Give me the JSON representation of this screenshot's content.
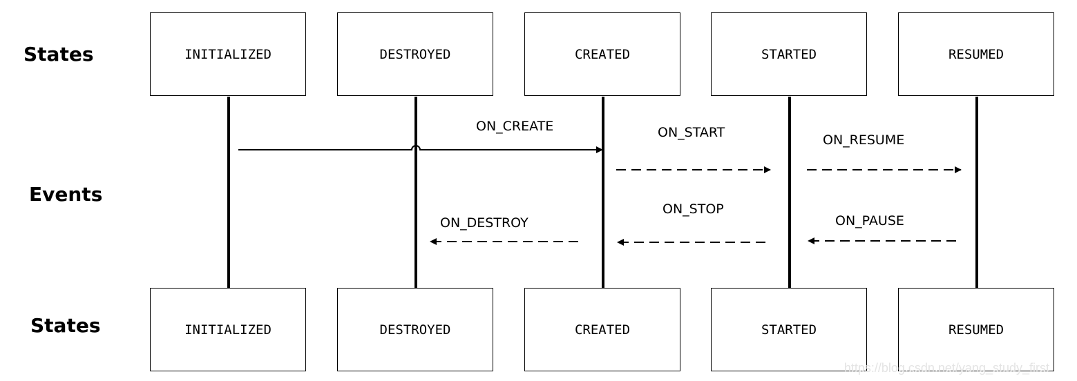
{
  "diagram": {
    "row_labels": {
      "top_states": "States",
      "events": "Events",
      "bottom_states": "States"
    },
    "states": [
      "INITIALIZED",
      "DESTROYED",
      "CREATED",
      "STARTED",
      "RESUMED"
    ],
    "events": [
      {
        "label": "ON_CREATE",
        "from": "INITIALIZED",
        "to": "CREATED",
        "style": "solid",
        "direction": "forward"
      },
      {
        "label": "ON_START",
        "from": "CREATED",
        "to": "STARTED",
        "style": "dashed",
        "direction": "forward"
      },
      {
        "label": "ON_RESUME",
        "from": "STARTED",
        "to": "RESUMED",
        "style": "dashed",
        "direction": "forward"
      },
      {
        "label": "ON_DESTROY",
        "from": "CREATED",
        "to": "DESTROYED",
        "style": "dashed",
        "direction": "backward"
      },
      {
        "label": "ON_STOP",
        "from": "STARTED",
        "to": "CREATED",
        "style": "dashed",
        "direction": "backward"
      },
      {
        "label": "ON_PAUSE",
        "from": "RESUMED",
        "to": "STARTED",
        "style": "dashed",
        "direction": "backward"
      }
    ],
    "watermark": "https://blog.csdn.net/yang_study_first"
  }
}
